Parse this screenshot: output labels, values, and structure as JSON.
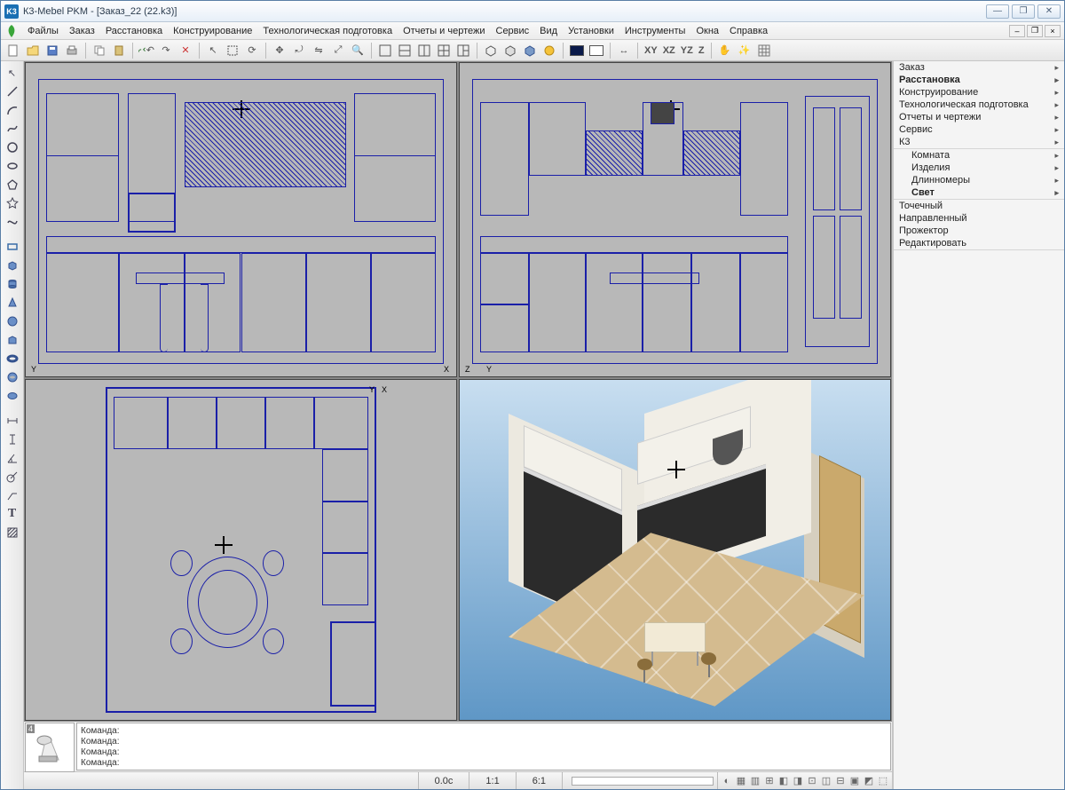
{
  "window": {
    "app_icon_text": "K3",
    "title": "К3-Mebel PKM - [Заказ_22 (22.k3)]"
  },
  "menu": {
    "items": [
      "Файлы",
      "Заказ",
      "Расстановка",
      "Конструирование",
      "Технологическая подготовка",
      "Отчеты и чертежи",
      "Сервис",
      "Вид",
      "Установки",
      "Инструменты",
      "Окна",
      "Справка"
    ]
  },
  "toolbar_axis": {
    "xy": "XY",
    "xz": "XZ",
    "yz": "YZ",
    "z": "Z"
  },
  "side_panel": {
    "group1": [
      {
        "label": "Заказ",
        "bold": false
      },
      {
        "label": "Расстановка",
        "bold": true
      },
      {
        "label": "Конструирование",
        "bold": false
      },
      {
        "label": "Технологическая подготовка",
        "bold": false
      },
      {
        "label": "Отчеты и чертежи",
        "bold": false
      },
      {
        "label": "Сервис",
        "bold": false
      },
      {
        "label": "К3",
        "bold": false
      }
    ],
    "group2": [
      {
        "label": "Комната",
        "bold": false
      },
      {
        "label": "Изделия",
        "bold": false
      },
      {
        "label": "Длинномеры",
        "bold": false
      },
      {
        "label": "Свет",
        "bold": true
      }
    ],
    "group3": [
      {
        "label": "Точечный"
      },
      {
        "label": "Направленный"
      },
      {
        "label": "Прожектор"
      },
      {
        "label": "Редактировать"
      }
    ]
  },
  "viewports": {
    "v1_axis_left": "Y",
    "v1_axis_right": "X",
    "v2_axis_left": "Z",
    "v2_axis_right": "Y",
    "v3_axis_left": "Y",
    "v3_axis_right": "X"
  },
  "bottom_panel": {
    "thumb_badge": "4",
    "cmd_label": "Команда:",
    "lines": 4
  },
  "statusbar": {
    "time": "0.0c",
    "ratio1": "1:1",
    "ratio2": "6:1"
  }
}
